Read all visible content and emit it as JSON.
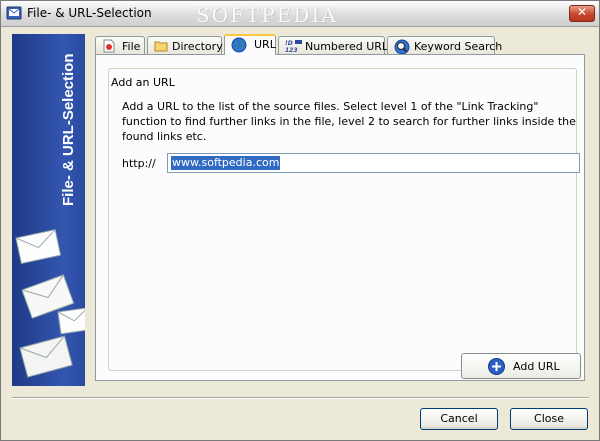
{
  "window": {
    "title": "File- & URL-Selection",
    "watermark": "SOFTPEDIA",
    "close_glyph": "✕"
  },
  "sidebar": {
    "title": "File- & URL-Selection",
    "image": "envelopes"
  },
  "tabs": [
    {
      "label": "File",
      "icon": "file-icon",
      "active": false
    },
    {
      "label": "Directory",
      "icon": "folder-icon",
      "active": false
    },
    {
      "label": "URL",
      "icon": "globe-icon",
      "active": true
    },
    {
      "label": "Numbered URLs",
      "icon": "numbered-urls-icon",
      "active": false
    },
    {
      "label": "Keyword Search",
      "icon": "keyword-search-icon",
      "active": false
    }
  ],
  "url_panel": {
    "group_title": "Add an URL",
    "description": "Add a URL to the list of the source files. Select level 1 of the \"Link Tracking\" function to find further links in the file, level 2 to search for further links inside the found links etc.",
    "prefix_label": "http://",
    "url_value": "www.softpedia.com",
    "add_button_label": "Add URL"
  },
  "footer": {
    "cancel_label": "Cancel",
    "close_label": "Close"
  },
  "colors": {
    "sidebar": "#2a4aa0",
    "active_tab_accent": "#ffc83c",
    "selection": "#316ac5"
  }
}
